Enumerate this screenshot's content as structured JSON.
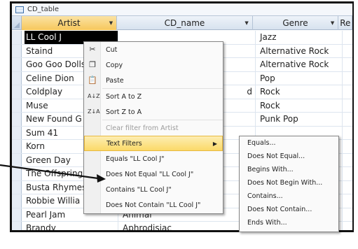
{
  "window": {
    "title": "CD_table"
  },
  "columns": [
    {
      "label": "Artist"
    },
    {
      "label": "CD_name"
    },
    {
      "label": "Genre"
    },
    {
      "label": "Re"
    }
  ],
  "rows": [
    {
      "artist": "LL Cool J",
      "cd": "",
      "genre": "Jazz"
    },
    {
      "artist": "Staind",
      "cd": "",
      "genre": "Alternative Rock"
    },
    {
      "artist": "Goo Goo Dolls",
      "cd": "",
      "genre": "Alternative Rock"
    },
    {
      "artist": "Celine Dion",
      "cd": "",
      "genre": "Pop"
    },
    {
      "artist": "Coldplay",
      "cd": "d",
      "genre": "Rock"
    },
    {
      "artist": "Muse",
      "cd": "",
      "genre": "Rock"
    },
    {
      "artist": "New Found G",
      "cd": "",
      "genre": "Punk Pop"
    },
    {
      "artist": "Sum 41",
      "cd": "",
      "genre": ""
    },
    {
      "artist": "Korn",
      "cd": "",
      "genre": ""
    },
    {
      "artist": "Green Day",
      "cd": "",
      "genre": ""
    },
    {
      "artist": "The Offspring",
      "cd": "",
      "genre": ""
    },
    {
      "artist": "Busta Rhymes",
      "cd": "",
      "genre": ""
    },
    {
      "artist": "Robbie Willia",
      "cd": "",
      "genre": ""
    },
    {
      "artist": "Pearl Jam",
      "cd": "Animal",
      "genre": ""
    },
    {
      "artist": "Brandy",
      "cd": "Aphrodisiac",
      "genre": ""
    }
  ],
  "context_menu": {
    "cut": "Cut",
    "copy": "Copy",
    "paste": "Paste",
    "sort_az": "Sort A to Z",
    "sort_za": "Sort Z to A",
    "clear_filter": "Clear filter from Artist",
    "text_filters": "Text Filters",
    "equals": "Equals \"LL Cool J\"",
    "not_equal": "Does Not Equal \"LL Cool J\"",
    "contains": "Contains \"LL Cool J\"",
    "not_contain": "Does Not Contain \"LL Cool J\""
  },
  "submenu": {
    "items": [
      "Equals...",
      "Does Not Equal...",
      "Begins With...",
      "Does Not Begin With...",
      "Contains...",
      "Does Not Contain...",
      "Ends With..."
    ]
  },
  "icons": {
    "cut": "scissors-icon",
    "copy": "copy-icon",
    "paste": "paste-icon",
    "sort_az": "sort-ascending-icon",
    "sort_za": "sort-descending-icon",
    "submenu": "chevron-right-icon"
  },
  "colors": {
    "highlight": "#fbd968",
    "selected_header": "#f6c75b",
    "active_cell": "#000000"
  }
}
